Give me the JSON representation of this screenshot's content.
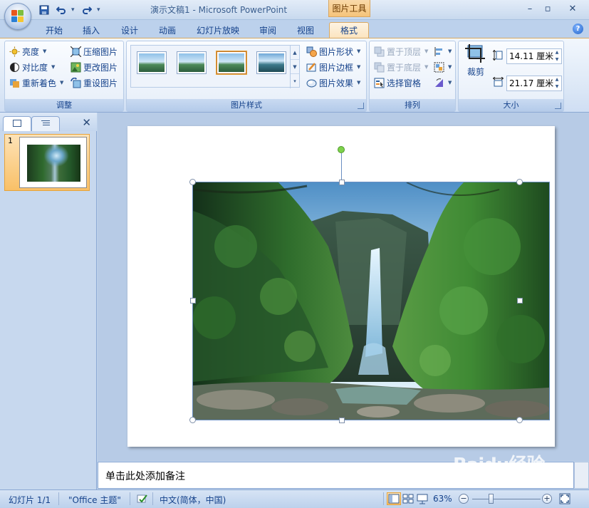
{
  "titlebar": {
    "title": "演示文稿1 - Microsoft PowerPoint",
    "context_tab_group": "图片工具",
    "minimize": "–",
    "maximize": "▫",
    "close": "✕",
    "qat": {
      "save_icon": "save-icon",
      "undo_icon": "undo-icon",
      "redo_icon": "redo-icon"
    }
  },
  "tabs": [
    {
      "label": "开始"
    },
    {
      "label": "插入"
    },
    {
      "label": "设计"
    },
    {
      "label": "动画"
    },
    {
      "label": "幻灯片放映"
    },
    {
      "label": "审阅"
    },
    {
      "label": "视图"
    },
    {
      "label": "格式",
      "active": true
    }
  ],
  "ribbon": {
    "adjust": {
      "label": "调整",
      "brightness": "亮度",
      "contrast": "对比度",
      "recolor": "重新着色",
      "compress": "压缩图片",
      "change": "更改图片",
      "reset": "重设图片"
    },
    "picture_styles": {
      "label": "图片样式",
      "shape": "图片形状",
      "border": "图片边框",
      "effects": "图片效果"
    },
    "arrange": {
      "label": "排列",
      "bring_front": "置于顶层",
      "send_back": "置于底层",
      "selection_pane": "选择窗格"
    },
    "size": {
      "label": "大小",
      "crop": "裁剪",
      "height": "14.11 厘米",
      "width": "21.17 厘米"
    }
  },
  "left_pane": {
    "slide_number": "1"
  },
  "notes": {
    "placeholder": "单击此处添加备注"
  },
  "status": {
    "slide": "幻灯片 1/1",
    "theme": "\"Office 主题\"",
    "language": "中文(简体，中国)",
    "zoom": "63%"
  },
  "watermark": "Baidu经验",
  "colors": {
    "accent": "#f9c067",
    "ribbon_blue": "#15428b"
  }
}
